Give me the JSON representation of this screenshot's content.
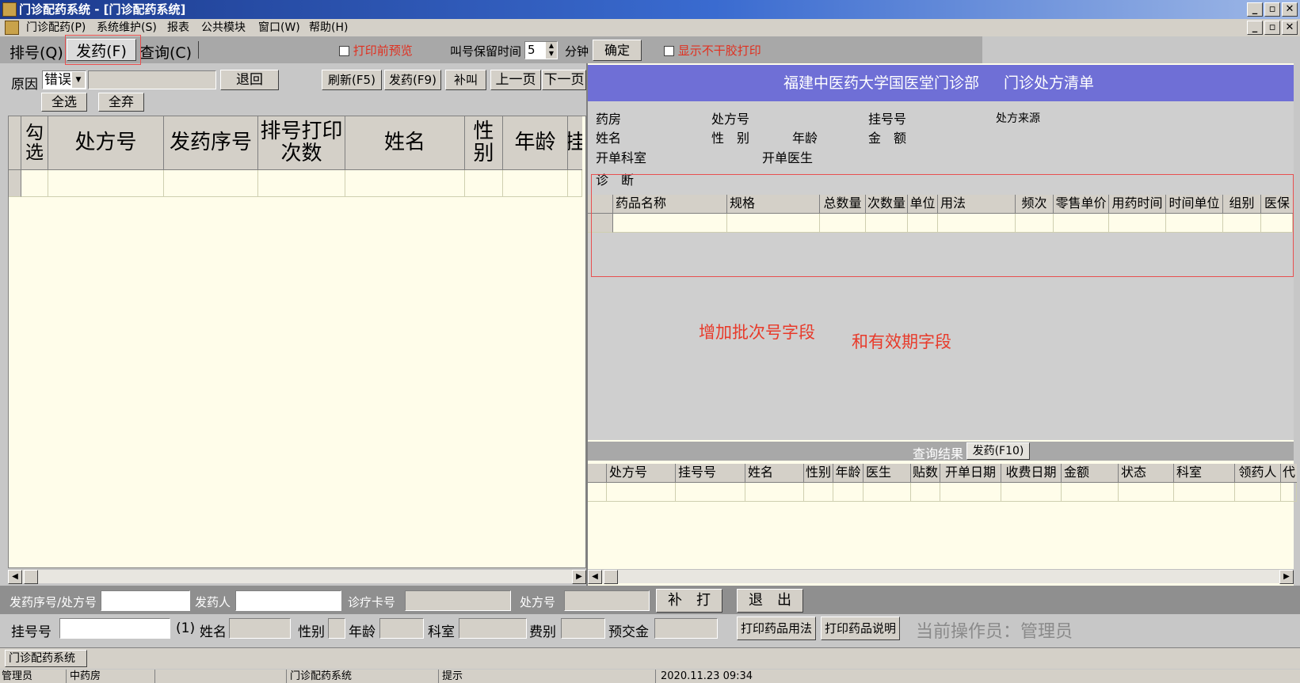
{
  "window": {
    "title": "门诊配药系统 - [门诊配药系统]"
  },
  "menu": [
    "门诊配药(P)",
    "系统维护(S)",
    "报表",
    "公共模块",
    "窗口(W)",
    "帮助(H)"
  ],
  "tabs": [
    "排号(Q)",
    "发药(F)",
    "查询(C)"
  ],
  "toolbar": {
    "print_preview": "打印前预览",
    "call_keep_label": "叫号保留时间",
    "call_keep_value": "5",
    "minutes": "分钟",
    "confirm": "确定",
    "show_no_dry_print": "显示不干胶打印"
  },
  "left": {
    "reason_label": "原因",
    "reason_value": "错误",
    "return_btn": "退回",
    "refresh_btn": "刷新(F5)",
    "dispense_btn": "发药(F9)",
    "recall_btn": "补叫",
    "prev_btn": "上一页",
    "next_btn": "下一页",
    "select_all": "全选",
    "discard_all": "全弃",
    "columns": [
      "勾选",
      "处方号",
      "发药序号",
      "排号打印次数",
      "姓名",
      "性别",
      "年龄",
      "挂"
    ]
  },
  "right": {
    "header_title": "福建中医药大学国医堂门诊部",
    "header_subtitle": "门诊处方清单",
    "info": {
      "pharmacy": "药房",
      "rx_no": "处方号",
      "reg_no": "挂号号",
      "rx_source": "处方来源",
      "name": "姓名",
      "gender": "性　别",
      "age": "年龄",
      "amount": "金　额",
      "dept": "开单科室",
      "doctor": "开单医生",
      "diagnosis": "诊　断"
    },
    "drug_columns": [
      "药品名称",
      "规格",
      "总数量",
      "次数量",
      "单位",
      "用法",
      "频次",
      "零售单价",
      "用药时间",
      "时间单位",
      "组别",
      "医保"
    ],
    "annotation1": "增加批次号字段",
    "annotation2": "和有效期字段",
    "query_result_label": "查询结果",
    "dispense_f10": "发药(F10)",
    "result_columns": [
      "处方号",
      "挂号号",
      "姓名",
      "性别",
      "年龄",
      "医生",
      "贴数",
      "开单日期",
      "收费日期",
      "金额",
      "状态",
      "科室",
      "领药人",
      "代"
    ]
  },
  "bottom": {
    "seq_label": "发药序号/处方号",
    "dispenser_label": "发药人",
    "card_label": "诊疗卡号",
    "rx_label": "处方号",
    "reprint_btn": "补　打",
    "exit_btn": "退　出",
    "reg_label": "挂号号",
    "reg_suffix": "(1)",
    "name_label": "姓名",
    "gender_label": "性别",
    "age_label": "年龄",
    "dept_label": "科室",
    "fee_label": "费别",
    "prepay_label": "预交金",
    "print_usage_btn": "打印药品用法",
    "print_desc_btn": "打印药品说明",
    "operator": "当前操作员：管理员"
  },
  "taskbar": {
    "item": "门诊配药系统"
  },
  "statusbar": [
    "管理员",
    "中药房",
    "",
    "门诊配药系统",
    "提示",
    "2020.11.23 09:34"
  ]
}
